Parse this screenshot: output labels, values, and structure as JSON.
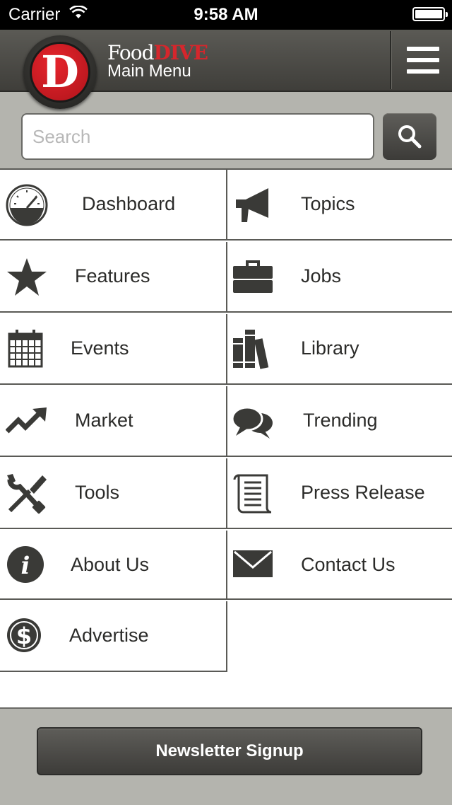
{
  "status_bar": {
    "carrier": "Carrier",
    "time": "9:58 AM"
  },
  "header": {
    "logo_letter": "D",
    "brand_food": "Food",
    "brand_dive": "DIVE",
    "subtitle": "Main Menu"
  },
  "search": {
    "placeholder": "Search",
    "value": ""
  },
  "menu": {
    "dashboard": "Dashboard",
    "topics": "Topics",
    "features": "Features",
    "jobs": "Jobs",
    "events": "Events",
    "library": "Library",
    "market": "Market",
    "trending": "Trending",
    "tools": "Tools",
    "press_release": "Press Release",
    "about_us": "About Us",
    "contact_us": "Contact Us",
    "advertise": "Advertise"
  },
  "footer": {
    "newsletter_label": "Newsletter Signup"
  },
  "colors": {
    "dark": "#3f3e3a",
    "accent_red": "#d6262c",
    "gray_bar": "#b4b4ae",
    "icon": "#3a3a37"
  },
  "icons": [
    "wifi-icon",
    "battery-icon",
    "hamburger-icon",
    "search-icon",
    "gauge-icon",
    "megaphone-icon",
    "star-icon",
    "briefcase-icon",
    "calendar-icon",
    "books-icon",
    "trend-arrow-icon",
    "speech-bubbles-icon",
    "tools-icon",
    "scroll-icon",
    "info-icon",
    "envelope-icon",
    "dollar-icon"
  ]
}
